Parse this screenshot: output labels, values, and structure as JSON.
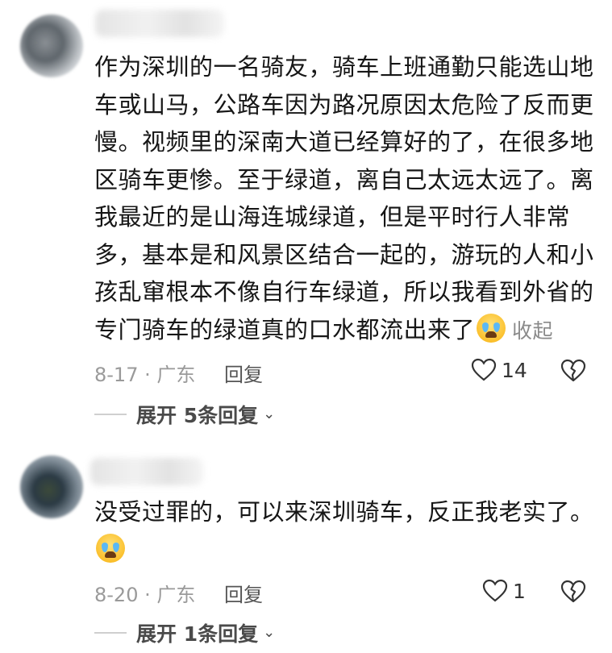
{
  "comments": [
    {
      "text": "作为深圳的一名骑友，骑车上班通勤只能选山地车或山马，公路车因为路况原因太危险了反而更慢。视频里的深南大道已经算好的了，在很多地区骑车更惨。至于绿道，离自己太远太远了。离我最近的是山海连城绿道，但是平时行人非常多，基本是和风景区结合一起的，游玩的人和小孩乱窜根本不像自行车绿道，所以我看到外省的专门骑车的绿道真的口水都流出来了",
      "collapse_label": "收起",
      "emoji": "crying-face",
      "date_location": "8-17 · 广东",
      "reply_label": "回复",
      "likes": "14",
      "expand_label": "展开 5条回复"
    },
    {
      "text": "没受过罪的，可以来深圳骑车，反正我老实了。",
      "emoji": "crying-face",
      "date_location": "8-20 · 广东",
      "reply_label": "回复",
      "likes": "1",
      "expand_label": "展开 1条回复"
    }
  ]
}
